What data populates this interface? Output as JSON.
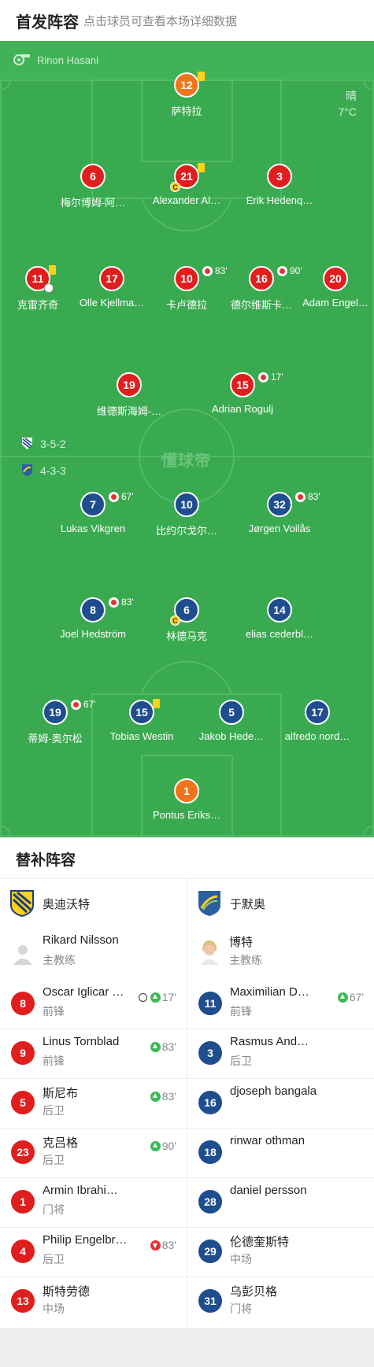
{
  "header": {
    "title": "首发阵容",
    "subtitle": "点击球员可查看本场详细数据"
  },
  "pitch": {
    "referee": "Rinon Hasani",
    "weather": "晴",
    "temperature": "7°C",
    "watermark": "懂球帝",
    "home_formation": "3-5-2",
    "away_formation": "4-3-3",
    "home_players": [
      {
        "num": "12",
        "name": "萨特拉",
        "color": "orange",
        "yellow": true
      },
      {
        "num": "6",
        "name": "梅尔博姆-阿…"
      },
      {
        "num": "21",
        "name": "Alexander Al…",
        "yellow": true,
        "captain": "C"
      },
      {
        "num": "3",
        "name": "Erik Hedenq…"
      },
      {
        "num": "11",
        "name": "克雷齐奇",
        "yellow": true
      },
      {
        "num": "17",
        "name": "Olle Kjellma…"
      },
      {
        "num": "10",
        "name": "卡卢德拉",
        "sub_min": "83'"
      },
      {
        "num": "16",
        "name": "德尔维斯卡…",
        "sub_min": "90'"
      },
      {
        "num": "20",
        "name": "Adam Engel…"
      },
      {
        "num": "19",
        "name": "维德斯海姆-…"
      },
      {
        "num": "15",
        "name": "Adrian Rogulj",
        "sub_min": "17'"
      }
    ],
    "away_players": [
      {
        "num": "7",
        "name": "Lukas Vikgren",
        "sub_min": "67'"
      },
      {
        "num": "10",
        "name": "比约尔戈尔…"
      },
      {
        "num": "32",
        "name": "Jørgen Voilås",
        "sub_min": "83'"
      },
      {
        "num": "8",
        "name": "Joel Hedström",
        "sub_min": "83'"
      },
      {
        "num": "6",
        "name": "林德马克",
        "captain": "C"
      },
      {
        "num": "14",
        "name": "elias cederbl…"
      },
      {
        "num": "19",
        "name": "蒂姆-奥尔松",
        "sub_min": "67'"
      },
      {
        "num": "15",
        "name": "Tobias Westin",
        "yellow": true
      },
      {
        "num": "5",
        "name": "Jakob Hede…"
      },
      {
        "num": "17",
        "name": "alfredo nord…"
      },
      {
        "num": "1",
        "name": "Pontus Eriks…",
        "color": "orange"
      }
    ]
  },
  "subs": {
    "title": "替补阵容",
    "home_team": "奥迪沃特",
    "away_team": "于默奥",
    "home_coach": {
      "name": "Rikard Nilsson",
      "role": "主教练"
    },
    "away_coach": {
      "name": "博特",
      "role": "主教练"
    },
    "home": [
      {
        "num": "8",
        "name": "Oscar Iglicar …",
        "pos": "前锋",
        "min": "17'",
        "dir": "in",
        "goal": true
      },
      {
        "num": "9",
        "name": "Linus Tornblad",
        "pos": "前锋",
        "min": "83'",
        "dir": "in"
      },
      {
        "num": "5",
        "name": "斯尼布",
        "pos": "后卫",
        "min": "83'",
        "dir": "in"
      },
      {
        "num": "23",
        "name": "克吕格",
        "pos": "后卫",
        "min": "90'",
        "dir": "in"
      },
      {
        "num": "1",
        "name": "Armin Ibrahi…",
        "pos": "门将",
        "min": "",
        "dir": ""
      },
      {
        "num": "4",
        "name": "Philip Engelbr…",
        "pos": "后卫",
        "min": "83'",
        "dir": "out"
      },
      {
        "num": "13",
        "name": "斯特劳德",
        "pos": "中场",
        "min": "",
        "dir": ""
      }
    ],
    "away": [
      {
        "num": "11",
        "name": "Maximilian D…",
        "pos": "前锋",
        "min": "67'",
        "dir": "in"
      },
      {
        "num": "3",
        "name": "Rasmus And…",
        "pos": "后卫",
        "min": "",
        "dir": ""
      },
      {
        "num": "16",
        "name": "djoseph bangala",
        "pos": "",
        "min": "",
        "dir": ""
      },
      {
        "num": "18",
        "name": "rinwar othman",
        "pos": "",
        "min": "",
        "dir": ""
      },
      {
        "num": "28",
        "name": "daniel persson",
        "pos": "",
        "min": "",
        "dir": ""
      },
      {
        "num": "29",
        "name": "伦德奎斯特",
        "pos": "中场",
        "min": "",
        "dir": ""
      },
      {
        "num": "31",
        "name": "乌彭贝格",
        "pos": "门将",
        "min": "",
        "dir": ""
      }
    ]
  }
}
